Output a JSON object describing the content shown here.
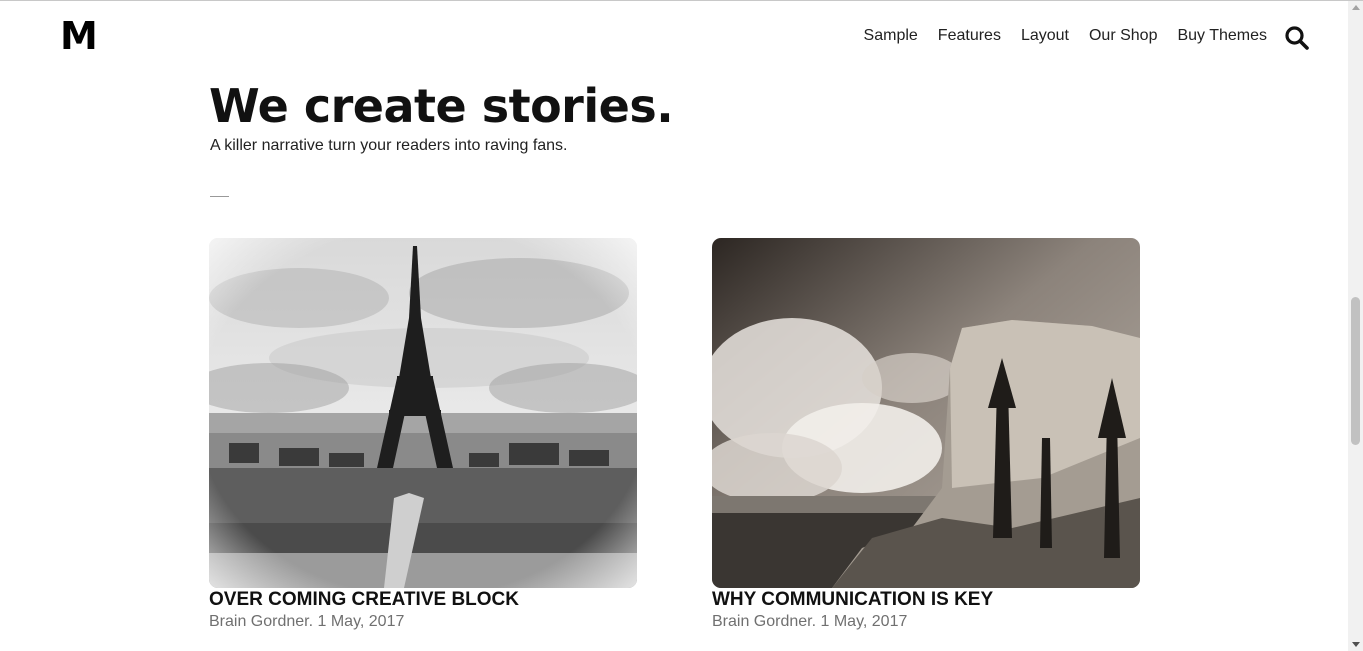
{
  "header": {
    "logo": "M",
    "nav": [
      "Sample",
      "Features",
      "Layout",
      "Our Shop",
      "Buy Themes"
    ],
    "search_icon": "search-icon"
  },
  "hero": {
    "title": "We create stories.",
    "subtitle": "A killer narrative turn your readers into raving fans."
  },
  "posts": [
    {
      "title": "OVER COMING CREATIVE BLOCK",
      "meta": "Brain Gordner. 1 May, 2017",
      "image": "eiffel-tower-photo"
    },
    {
      "title": "WHY COMMUNICATION IS KEY",
      "meta": "Brain Gordner. 1 May, 2017",
      "image": "cliff-landscape-photo"
    }
  ]
}
